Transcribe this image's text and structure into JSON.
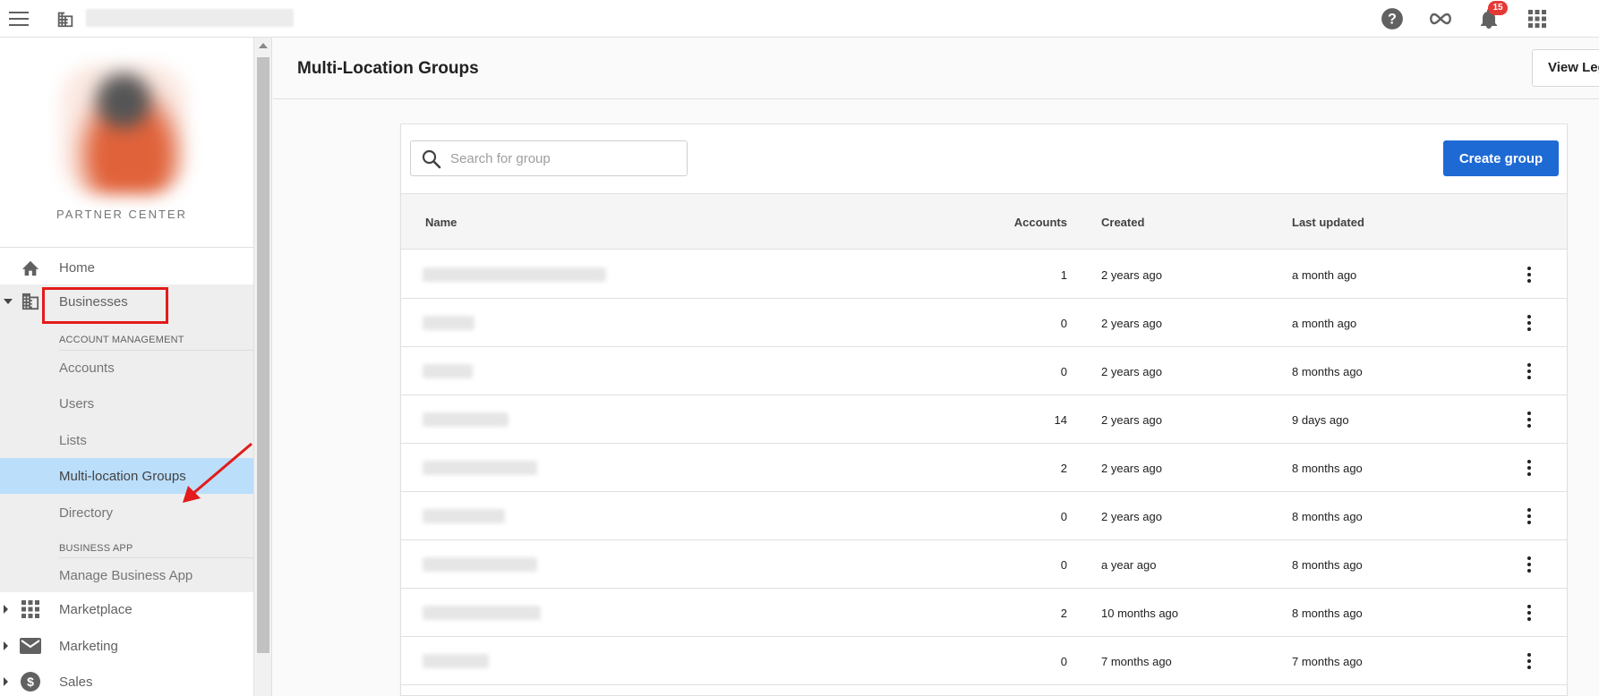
{
  "sidebar": {
    "brand": "PARTNER CENTER",
    "home": "Home",
    "businesses": "Businesses",
    "account_management_header": "ACCOUNT MANAGEMENT",
    "accounts": "Accounts",
    "users": "Users",
    "lists": "Lists",
    "multi_location_groups": "Multi-location Groups",
    "directory": "Directory",
    "business_app_header": "BUSINESS APP",
    "manage_business_app": "Manage Business App",
    "marketplace": "Marketplace",
    "marketing": "Marketing",
    "sales": "Sales"
  },
  "topbar": {
    "notification_count": "15",
    "icons": [
      "menu-icon",
      "building-icon",
      "help-icon",
      "infinity-icon",
      "bell-icon",
      "apps-grid-icon"
    ]
  },
  "main": {
    "title": "Multi-Location Groups",
    "view_legacy_label": "View Legacy"
  },
  "card": {
    "search_placeholder": "Search for group",
    "create_label": "Create group",
    "columns": {
      "name": "Name",
      "accounts": "Accounts",
      "created": "Created",
      "updated": "Last updated"
    },
    "rows": [
      {
        "accounts": "1",
        "created": "2 years ago",
        "updated": "a month ago"
      },
      {
        "accounts": "0",
        "created": "2 years ago",
        "updated": "a month ago"
      },
      {
        "accounts": "0",
        "created": "2 years ago",
        "updated": "8 months ago"
      },
      {
        "accounts": "14",
        "created": "2 years ago",
        "updated": "9 days ago"
      },
      {
        "accounts": "2",
        "created": "2 years ago",
        "updated": "8 months ago"
      },
      {
        "accounts": "0",
        "created": "2 years ago",
        "updated": "8 months ago"
      },
      {
        "accounts": "0",
        "created": "a year ago",
        "updated": "8 months ago"
      },
      {
        "accounts": "2",
        "created": "10 months ago",
        "updated": "8 months ago"
      },
      {
        "accounts": "0",
        "created": "7 months ago",
        "updated": "7 months ago"
      }
    ]
  },
  "colors": {
    "primary": "#1e6ad4",
    "active_nav": "#bbdefb",
    "annotation_red": "#e31b1b",
    "badge_red": "#e53935"
  }
}
